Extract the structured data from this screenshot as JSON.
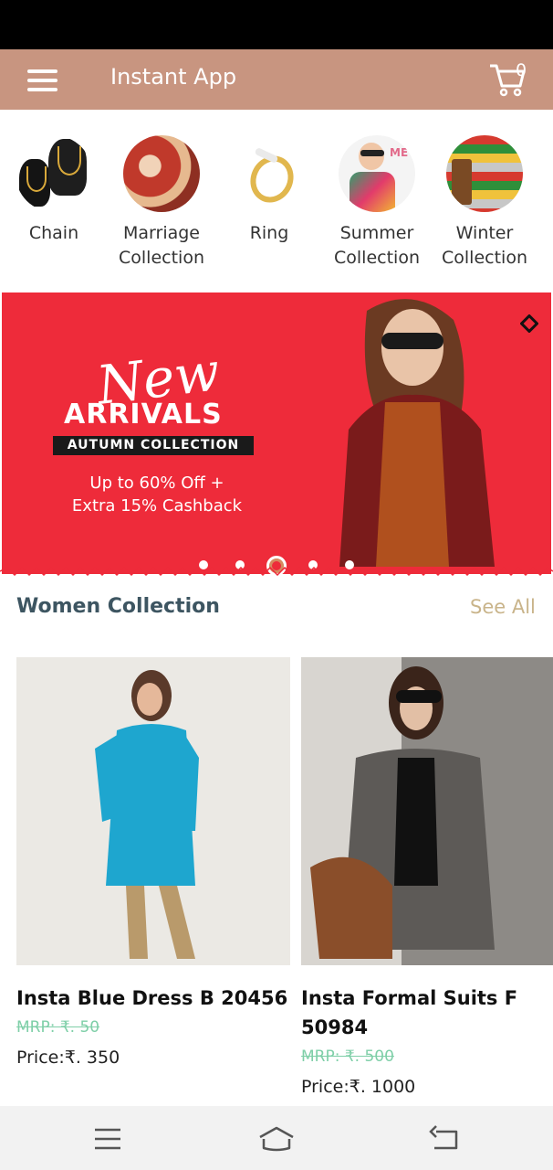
{
  "app": {
    "title": "Instant App",
    "cart_count": "0"
  },
  "categories": [
    {
      "label": "Chain"
    },
    {
      "label": "Marriage Collection"
    },
    {
      "label": "Ring"
    },
    {
      "label": "Summer Collection"
    },
    {
      "label": "Winter Collection"
    }
  ],
  "banner": {
    "line1": "New",
    "line2": "ARRIVALS",
    "tag": "AUTUMN COLLECTION",
    "offer1": "Up to 60% Off +",
    "offer2": "Extra 15% Cashback",
    "total_slides": 5,
    "active_slide": 2
  },
  "section": {
    "title": "Women Collection",
    "see_all": "See All"
  },
  "products": [
    {
      "name": "Insta Blue Dress B 20456",
      "mrp": "MRP: ₹. 50",
      "price": "Price:₹. 350"
    },
    {
      "name": "Insta Formal Suits F 50984",
      "mrp": "MRP: ₹. 500",
      "price": "Price:₹. 1000"
    }
  ],
  "colors": {
    "app_bar": "#c89580",
    "banner": "#ee2b3a",
    "section_title": "#3d5561",
    "see_all": "#c9b48a",
    "mrp": "#7fcfa8"
  }
}
